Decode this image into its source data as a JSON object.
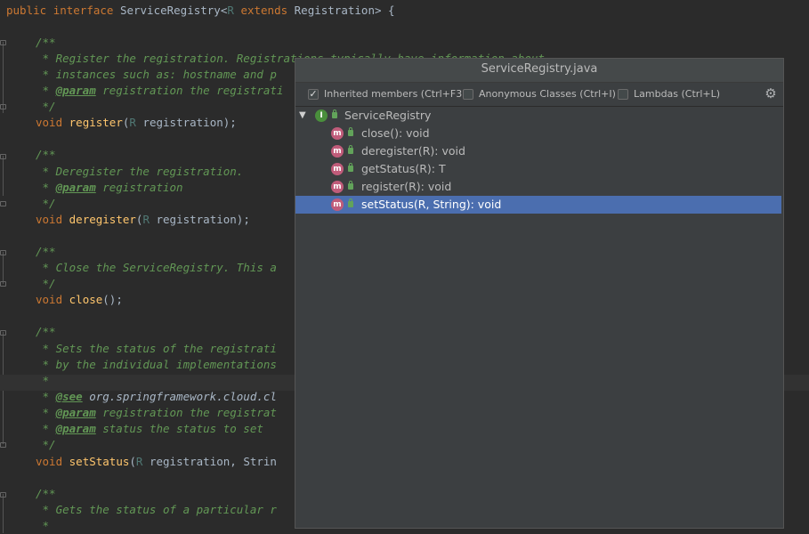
{
  "editor": {
    "lines": {
      "l1": {
        "kw1": "public",
        "kw2": "interface",
        "name": "ServiceRegistry<",
        "tp": "R",
        "kw3": "extends",
        "rest": "Registration> {"
      },
      "l3": "/**",
      "l4": " * Register the registration. Registrations typically have information about",
      "l5": " * instances such as: hostname and p",
      "l6": {
        "pre": " * ",
        "tag": "@param",
        "rest": " registration the registrati"
      },
      "l7": " */",
      "l8": {
        "kw": "void",
        "fn": "register",
        "p1": "(",
        "tp": "R",
        "p2": " registration);"
      },
      "l10": "/**",
      "l11": " * Deregister the registration.",
      "l12": {
        "pre": " * ",
        "tag": "@param",
        "rest": " registration"
      },
      "l13": " */",
      "l14": {
        "kw": "void",
        "fn": "deregister",
        "p1": "(",
        "tp": "R",
        "p2": " registration);"
      },
      "l16": "/**",
      "l17": " * Close the ServiceRegistry. This a",
      "l18": " */",
      "l19": {
        "kw": "void",
        "fn": "close",
        "p1": "();"
      },
      "l21": "/**",
      "l22": " * Sets the status of the registrati",
      "l23": " * by the individual implementations",
      "l24": " *",
      "l25": {
        "pre": " * ",
        "tag": "@see",
        "ref": " org.springframework.cloud.cl"
      },
      "l26": {
        "pre": " * ",
        "tag": "@param",
        "rest": " registration the registrat"
      },
      "l27": {
        "pre": " * ",
        "tag": "@param",
        "rest": " status the status to set"
      },
      "l28": " */",
      "l29": {
        "kw": "void",
        "fn": "setStatus",
        "p1": "(",
        "tp": "R",
        "p2": " registration, Strin"
      },
      "l31": "/**",
      "l32": " * Gets the status of a particular r",
      "l33": " *"
    }
  },
  "popup": {
    "title": "ServiceRegistry.java",
    "options": {
      "inherited": {
        "label": "Inherited members (Ctrl+F3)",
        "checked": true
      },
      "anonymous": {
        "label": "Anonymous Classes (Ctrl+I)",
        "checked": false
      },
      "lambdas": {
        "label": "Lambdas (Ctrl+L)",
        "checked": false
      }
    },
    "tree": {
      "root": {
        "label": "ServiceRegistry",
        "icon": "interface-icon"
      },
      "members": [
        {
          "label": "close(): void",
          "icon": "method-icon"
        },
        {
          "label": "deregister(R): void",
          "icon": "method-icon"
        },
        {
          "label": "getStatus(R): T",
          "icon": "method-icon"
        },
        {
          "label": "register(R): void",
          "icon": "method-icon"
        },
        {
          "label": "setStatus(R, String): void",
          "icon": "method-icon"
        }
      ],
      "selected_index": 4
    }
  },
  "colors": {
    "editor_bg": "#2b2b2b",
    "keyword": "#cc7832",
    "comment": "#629755",
    "method": "#ffc66d",
    "popup_bg": "#3c3f41",
    "selection": "#4b6eaf"
  }
}
